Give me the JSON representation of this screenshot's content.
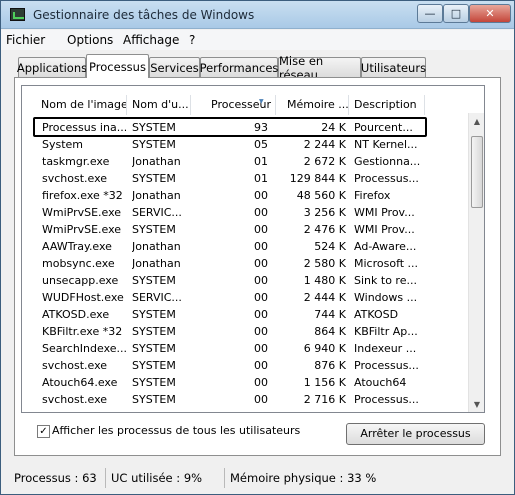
{
  "window": {
    "title": "Gestionnaire des tâches de Windows"
  },
  "menu": [
    "Fichier",
    "Options",
    "Affichage",
    "?"
  ],
  "tabs": [
    "Applications",
    "Processus",
    "Services",
    "Performances",
    "Mise en réseau",
    "Utilisateurs"
  ],
  "active_tab": "Processus",
  "columns": [
    "Nom de l'image",
    "Nom d'u...",
    "Processeur",
    "Mémoire ...",
    "Description"
  ],
  "sorted_column": "Processeur",
  "rows": [
    [
      "Processus ina...",
      "SYSTEM",
      "93",
      "24 K",
      "Pourcent..."
    ],
    [
      "System",
      "SYSTEM",
      "05",
      "2 244 K",
      "NT Kernel..."
    ],
    [
      "taskmgr.exe",
      "Jonathan",
      "01",
      "2 672 K",
      "Gestionna..."
    ],
    [
      "svchost.exe",
      "SYSTEM",
      "01",
      "129 844 K",
      "Processus..."
    ],
    [
      "firefox.exe *32",
      "Jonathan",
      "00",
      "48 560 K",
      "Firefox"
    ],
    [
      "WmiPrvSE.exe",
      "SERVIC...",
      "00",
      "3 256 K",
      "WMI Prov..."
    ],
    [
      "WmiPrvSE.exe",
      "SYSTEM",
      "00",
      "2 476 K",
      "WMI Prov..."
    ],
    [
      "AAWTray.exe",
      "Jonathan",
      "00",
      "524 K",
      "Ad-Aware..."
    ],
    [
      "mobsync.exe",
      "Jonathan",
      "00",
      "2 580 K",
      "Microsoft ..."
    ],
    [
      "unsecapp.exe",
      "SYSTEM",
      "00",
      "1 480 K",
      "Sink to re..."
    ],
    [
      "WUDFHost.exe",
      "SERVIC...",
      "00",
      "2 444 K",
      "Windows ..."
    ],
    [
      "ATKOSD.exe",
      "SYSTEM",
      "00",
      "744 K",
      "ATKOSD"
    ],
    [
      "KBFiltr.exe *32",
      "SYSTEM",
      "00",
      "864 K",
      "KBFiltr Ap..."
    ],
    [
      "SearchIndexe...",
      "SYSTEM",
      "00",
      "6 940 K",
      "Indexeur ..."
    ],
    [
      "svchost.exe",
      "SYSTEM",
      "00",
      "876 K",
      "Processus..."
    ],
    [
      "Atouch64.exe",
      "SYSTEM",
      "00",
      "1 156 K",
      "Atouch64"
    ],
    [
      "svchost.exe",
      "SYSTEM",
      "00",
      "2 716 K",
      "Processus..."
    ]
  ],
  "show_all_users": {
    "checked": true,
    "label": "Afficher les processus de tous les utilisateurs"
  },
  "end_process_label": "Arrêter le processus",
  "status": {
    "processes": "Processus : 63",
    "cpu": "UC utilisée : 9%",
    "memory": "Mémoire physique : 33 %"
  },
  "icons": [
    "app-icon",
    "minimize-icon",
    "maximize-icon",
    "close-icon",
    "sort-arrow-icon",
    "checkmark-icon",
    "scroll-up-icon",
    "scroll-down-icon"
  ]
}
